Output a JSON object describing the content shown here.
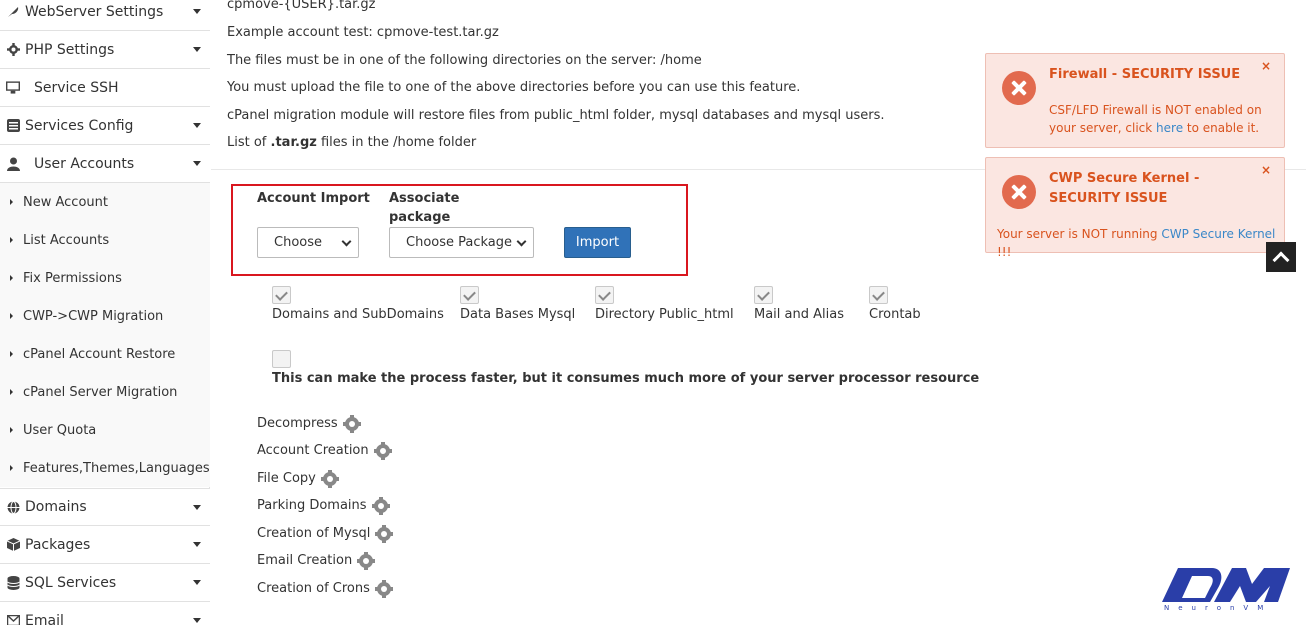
{
  "sidebar": {
    "top_items": [
      {
        "label": "WebServer Settings",
        "icon": "feather-icon"
      },
      {
        "label": "PHP Settings",
        "icon": "gear-icon"
      },
      {
        "label": "Service SSH",
        "icon": "monitor-icon"
      },
      {
        "label": "Services Config",
        "icon": "list-icon"
      },
      {
        "label": "User Accounts",
        "icon": "user-icon"
      }
    ],
    "sub_items": [
      {
        "label": "New Account"
      },
      {
        "label": "List Accounts"
      },
      {
        "label": "Fix Permissions"
      },
      {
        "label": "CWP->CWP Migration"
      },
      {
        "label": "cPanel Account Restore"
      },
      {
        "label": "cPanel Server Migration"
      },
      {
        "label": "User Quota"
      },
      {
        "label": "Features,Themes,Languages"
      }
    ],
    "bottom_items": [
      {
        "label": "Domains",
        "icon": "globe-icon"
      },
      {
        "label": "Packages",
        "icon": "cube-icon"
      },
      {
        "label": "SQL Services",
        "icon": "database-icon"
      },
      {
        "label": "Email",
        "icon": "envelope-icon"
      }
    ]
  },
  "main": {
    "info_lines": [
      "cpmove-{USER}.tar.gz",
      "Example account test: cpmove-test.tar.gz",
      "The files must be in one of the following directories on the server: /home",
      "You must upload the file to one of the above directories before you can use this feature.",
      "cPanel migration module will restore files from public_html folder, mysql databases and mysql users."
    ],
    "list_prefix": "List of ",
    "list_ext": ".tar.gz",
    "list_suffix": " files in the /home folder",
    "import": {
      "account_label": "Account Import",
      "package_label": "Associate package",
      "account_select": "Choose",
      "package_select": "Choose Package",
      "import_button": "Import"
    },
    "options": [
      {
        "label": "Domains and SubDomains",
        "checked": true
      },
      {
        "label": "Data Bases Mysql",
        "checked": true
      },
      {
        "label": "Directory Public_html",
        "checked": true
      },
      {
        "label": "Mail and Alias",
        "checked": true
      },
      {
        "label": "Crontab",
        "checked": true
      }
    ],
    "fast_option_checked": false,
    "fast_option_text": "This can make the process faster, but it consumes much more of your server processor resource",
    "steps": [
      "Decompress",
      "Account Creation",
      "File Copy",
      "Parking Domains",
      "Creation of Mysql",
      "Email Creation",
      "Creation of Crons"
    ]
  },
  "alerts": [
    {
      "title": "Firewall - SECURITY ISSUE",
      "body_prefix": "CSF/LFD Firewall is NOT enabled on your server, click ",
      "link": "here",
      "body_suffix": " to enable it.",
      "close": "×"
    },
    {
      "title": "CWP Secure Kernel - SECURITY ISSUE",
      "body_prefix": "Your server is NOT running ",
      "link": "CWP Secure Kernel",
      "body_suffix": " !!!",
      "close": "×"
    }
  ],
  "logo_text": "NeuronVM",
  "colors": {
    "accent_button": "#3072b8",
    "highlight_border": "#d9171f",
    "alert_text": "#d9531e",
    "alert_bg": "#fbe6e1",
    "link": "#3a87c8",
    "logo": "#2a3ea8"
  }
}
